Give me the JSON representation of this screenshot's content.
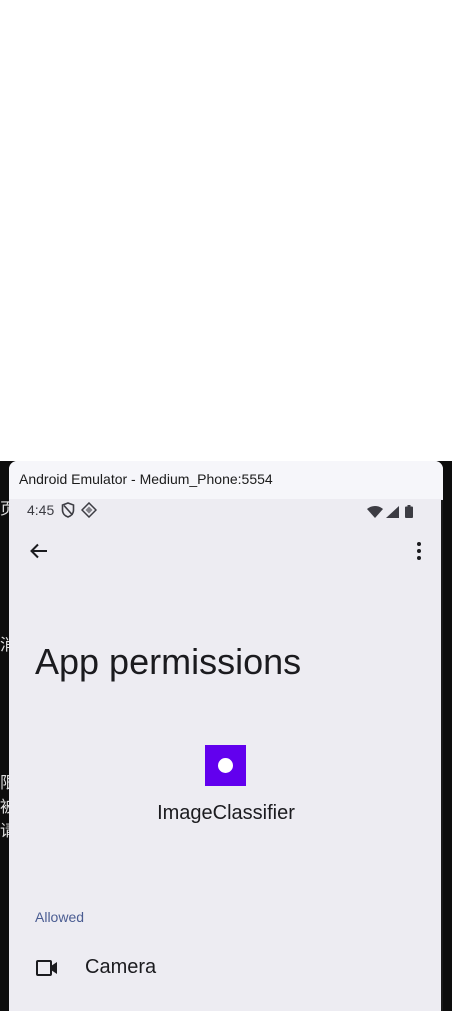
{
  "window": {
    "title": "Android Emulator - Medium_Phone:5554"
  },
  "side_glyphs": [
    "页",
    "消",
    "限",
    "被",
    "请"
  ],
  "status_bar": {
    "time": "4:45",
    "left_icons": [
      "shield-icon",
      "vpn-diamond-icon"
    ],
    "right_icons": [
      "wifi-icon",
      "cell-signal-icon",
      "battery-icon"
    ]
  },
  "toolbar": {
    "back_icon": "arrow-left-icon",
    "more_icon": "more-vert-icon"
  },
  "page": {
    "title": "App permissions",
    "app_name": "ImageClassifier",
    "app_icon_color": "#6200ee"
  },
  "permissions": {
    "section_label": "Allowed",
    "section_color": "#4a5c92",
    "items": [
      {
        "label": "Camera",
        "icon": "videocam-icon"
      }
    ]
  }
}
